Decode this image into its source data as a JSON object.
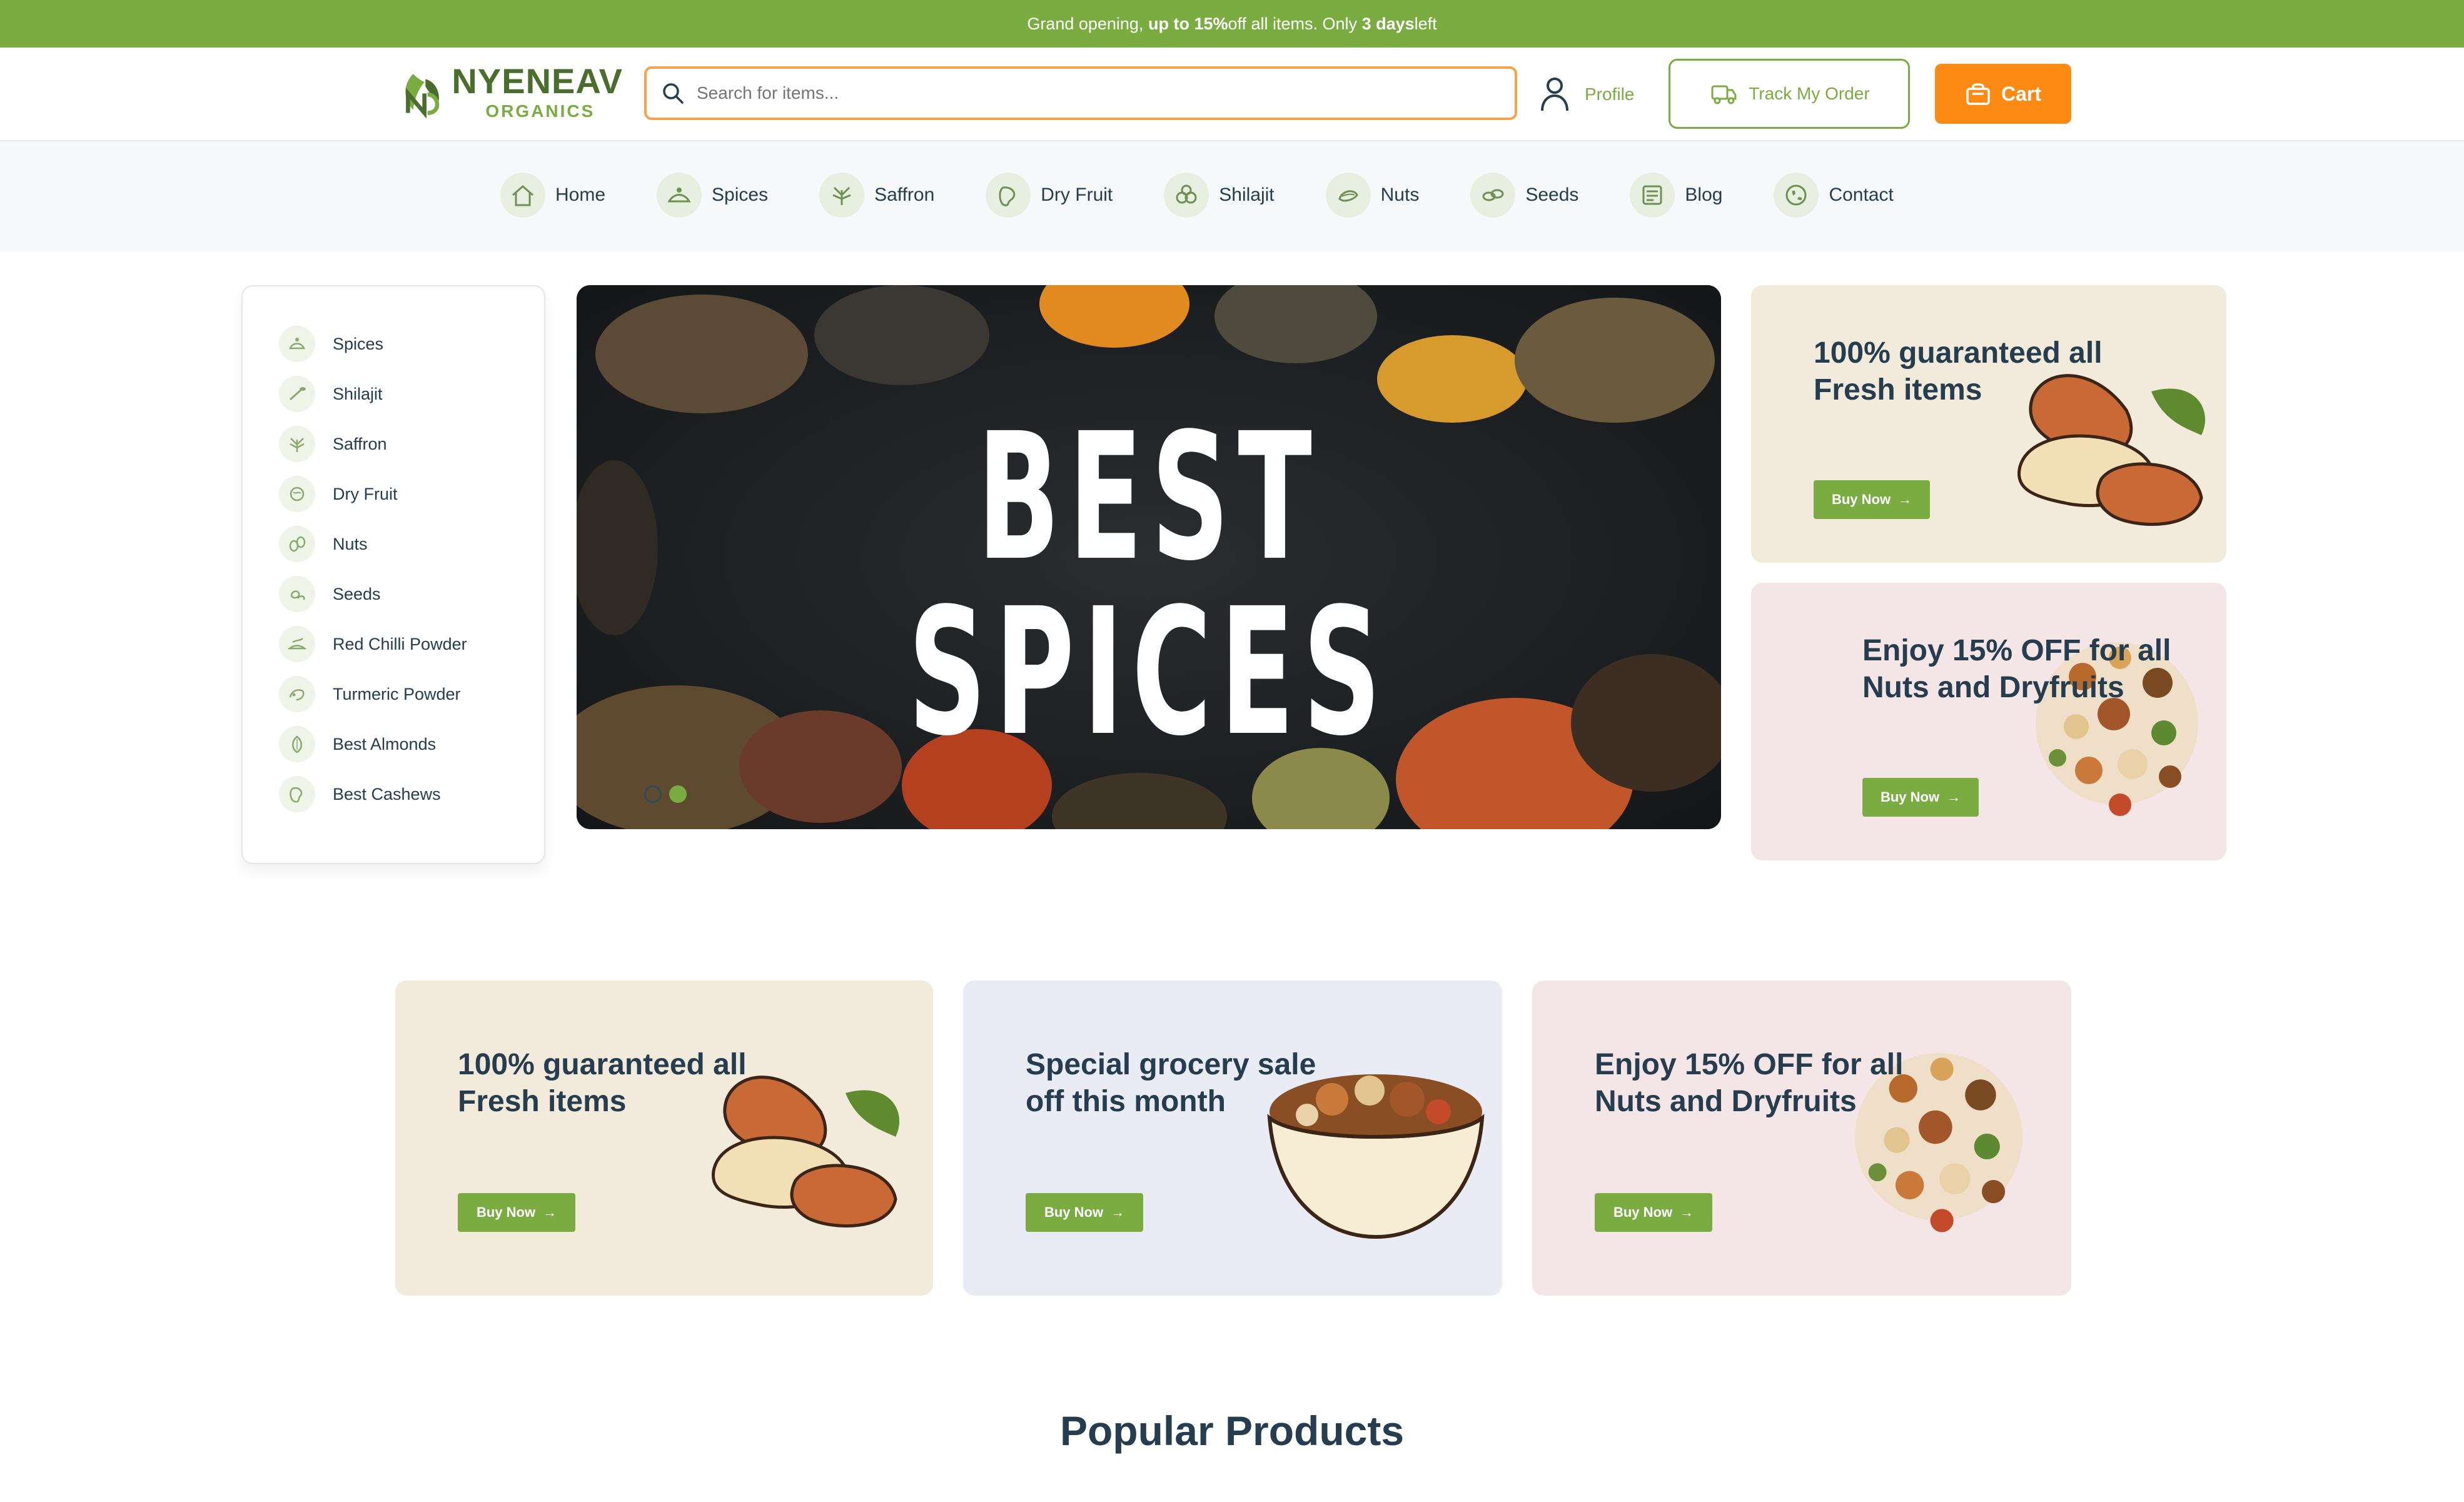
{
  "topbar": {
    "prefix": "Grand opening, ",
    "highlight1": "up to 15%",
    "middle": " off all items. Only ",
    "highlight2": "3 days",
    "suffix": " left"
  },
  "header": {
    "logo_name": "NYENEAV",
    "logo_sub": "ORGANICS",
    "search_placeholder": "Search for items...",
    "profile_label": "Profile",
    "track_label": "Track My Order",
    "cart_label": "Cart"
  },
  "nav": {
    "items": [
      {
        "label": "Home",
        "icon": "home-icon"
      },
      {
        "label": "Spices",
        "icon": "spices-icon"
      },
      {
        "label": "Saffron",
        "icon": "saffron-icon"
      },
      {
        "label": "Dry Fruit",
        "icon": "dry-fruit-icon"
      },
      {
        "label": "Shilajit",
        "icon": "shilajit-icon"
      },
      {
        "label": "Nuts",
        "icon": "nuts-icon"
      },
      {
        "label": "Seeds",
        "icon": "seeds-icon"
      },
      {
        "label": "Blog",
        "icon": "blog-icon"
      },
      {
        "label": "Contact",
        "icon": "phone-icon"
      }
    ]
  },
  "sidebar": {
    "items": [
      {
        "label": "Spices"
      },
      {
        "label": "Shilajit"
      },
      {
        "label": "Saffron"
      },
      {
        "label": "Dry Fruit"
      },
      {
        "label": "Nuts"
      },
      {
        "label": "Seeds"
      },
      {
        "label": "Red Chilli Powder"
      },
      {
        "label": "Turmeric Powder"
      },
      {
        "label": "Best Almonds"
      },
      {
        "label": "Best Cashews"
      }
    ]
  },
  "hero": {
    "title": "BEST SPICES",
    "active_slide": 2,
    "slide_count": 2
  },
  "side_promos": [
    {
      "title_line1": "100% guaranteed all",
      "title_line2": "Fresh items",
      "button": "Buy Now"
    },
    {
      "title_line1": "Enjoy 15% OFF for all",
      "title_line2": "Nuts and Dryfruits",
      "button": "Buy Now"
    }
  ],
  "promo_cards": [
    {
      "title_line1": "100% guaranteed all",
      "title_line2": "Fresh items",
      "button": "Buy Now"
    },
    {
      "title_line1": "Special grocery sale",
      "title_line2": "off this month",
      "button": "Buy Now"
    },
    {
      "title_line1": "Enjoy 15% OFF for all",
      "title_line2": "Nuts and Dryfruits",
      "button": "Buy Now"
    }
  ],
  "section_title": "Popular Products",
  "colors": {
    "brand_green": "#7bac42",
    "cart_orange": "#fd8a14",
    "search_border": "#f3a54d",
    "heading": "#253d4e",
    "card_beige": "#f2ebdc",
    "card_pink": "#f4e6e6",
    "card_lavender": "#e9ecf5"
  }
}
